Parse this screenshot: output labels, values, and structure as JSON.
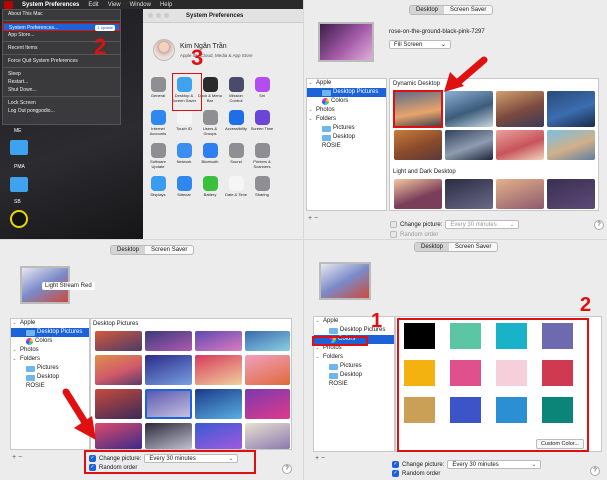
{
  "q1": {
    "menubar": {
      "app": "System Preferences",
      "items": [
        "Edit",
        "View",
        "Window",
        "Help"
      ]
    },
    "apple_menu": {
      "items": [
        "About This Mac",
        "System Preferences...",
        "App Store...",
        "Recent Items",
        "Force Quit System Preferences",
        "Sleep",
        "Restart...",
        "Shut Down...",
        "Lock Screen",
        "Log Out pongpodio..."
      ],
      "update_badge": "1 update"
    },
    "step_number_2": "2",
    "step_number_3": "3",
    "desktop_icons": [
      "ME",
      "PMA",
      "SB"
    ],
    "prefs": {
      "title": "System Preferences",
      "user_name": "Kim Ngân Trần",
      "user_sub": "Apple ID, iCloud, Media & App Store",
      "panes": [
        {
          "label": "General",
          "color": "#8e8e93"
        },
        {
          "label": "Desktop & Screen Saver",
          "color": "#3ea2ee"
        },
        {
          "label": "Dock & Menu Bar",
          "color": "#2b2b2b"
        },
        {
          "label": "Mission Control",
          "color": "#4a4a6a"
        },
        {
          "label": "Siri",
          "color": "#b44df0"
        },
        {
          "label": "",
          "color": "#ececec"
        },
        {
          "label": "Internet Accounts",
          "color": "#2f87f0"
        },
        {
          "label": "Touch ID",
          "color": "#f5f5f5"
        },
        {
          "label": "Users & Groups",
          "color": "#8e8e93"
        },
        {
          "label": "Accessibility",
          "color": "#1d6ee8"
        },
        {
          "label": "Screen Time",
          "color": "#6b45d8"
        },
        {
          "label": "",
          "color": "#ececec"
        },
        {
          "label": "Software Update",
          "color": "#8e8e93"
        },
        {
          "label": "Network",
          "color": "#3a8ef0"
        },
        {
          "label": "Bluetooth",
          "color": "#2f7ff0"
        },
        {
          "label": "Sound",
          "color": "#8e8e93"
        },
        {
          "label": "Printers & Scanners",
          "color": "#8e8e93"
        },
        {
          "label": "",
          "color": "#ececec"
        },
        {
          "label": "Displays",
          "color": "#3a9cf0"
        },
        {
          "label": "Sidecar",
          "color": "#2f87f0"
        },
        {
          "label": "Battery",
          "color": "#39c03c"
        },
        {
          "label": "Date & Time",
          "color": "#f5f5f5"
        },
        {
          "label": "Sharing",
          "color": "#8e8e93"
        }
      ]
    }
  },
  "q2": {
    "tabs": [
      "Desktop",
      "Screen Saver"
    ],
    "wallpaper_name": "rose-on-the-ground-black-pink-7297",
    "fit": "Fill Screen",
    "sidebar": [
      {
        "label": "Apple",
        "type": "group"
      },
      {
        "label": "Desktop Pictures",
        "type": "sel"
      },
      {
        "label": "Colors",
        "type": "color"
      },
      {
        "label": "Photos",
        "type": "group"
      },
      {
        "label": "Folders",
        "type": "group"
      },
      {
        "label": "Pictures",
        "type": "folder"
      },
      {
        "label": "Desktop",
        "type": "folder"
      },
      {
        "label": "ROSIE",
        "type": "plain"
      }
    ],
    "section1": "Dynamic Desktop",
    "section2": "Light and Dark Desktop",
    "change_picture": "Change picture:",
    "interval": "Every 30 minutes",
    "random_order": "Random order"
  },
  "q3": {
    "tabs": [
      "Desktop",
      "Screen Saver"
    ],
    "wallpaper_name": "Light Stream Red",
    "sidebar": [
      {
        "label": "Apple",
        "type": "group"
      },
      {
        "label": "Desktop Pictures",
        "type": "sel"
      },
      {
        "label": "Colors",
        "type": "color"
      },
      {
        "label": "Photos",
        "type": "group"
      },
      {
        "label": "Folders",
        "type": "group"
      },
      {
        "label": "Pictures",
        "type": "folder"
      },
      {
        "label": "Desktop",
        "type": "folder"
      },
      {
        "label": "ROSIE",
        "type": "plain"
      }
    ],
    "section": "Desktop Pictures",
    "change_picture": "Change picture:",
    "interval": "Every 30 minutes",
    "random_order": "Random order"
  },
  "q4": {
    "tabs": [
      "Desktop",
      "Screen Saver"
    ],
    "sidebar": [
      {
        "label": "Apple",
        "type": "group"
      },
      {
        "label": "Desktop Pictures",
        "type": "folder"
      },
      {
        "label": "Colors",
        "type": "sel-color"
      },
      {
        "label": "Photos",
        "type": "group"
      },
      {
        "label": "Folders",
        "type": "group"
      },
      {
        "label": "Pictures",
        "type": "folder"
      },
      {
        "label": "Desktop",
        "type": "folder"
      },
      {
        "label": "ROSIE",
        "type": "plain"
      }
    ],
    "step_number_1": "1",
    "step_number_2": "2",
    "swatches": [
      "#000000",
      "#5cc6a4",
      "#19b3c9",
      "#6e6ab0",
      "#f4b210",
      "#e0508c",
      "#f5cfd9",
      "#d03a50",
      "#c9a055",
      "#3d54c8",
      "#2b8fd4",
      "#0b8577"
    ],
    "custom_color": "Custom Color...",
    "change_picture": "Change picture:",
    "interval": "Every 30 minutes",
    "random_order": "Random order"
  }
}
